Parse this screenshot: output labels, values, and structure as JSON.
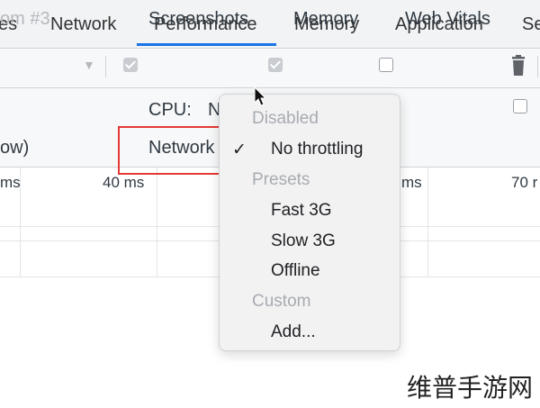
{
  "tabs": [
    {
      "label": "es",
      "active": false
    },
    {
      "label": "Network",
      "active": false
    },
    {
      "label": "Performance",
      "active": true
    },
    {
      "label": "Memory",
      "active": false
    },
    {
      "label": "Application",
      "active": false
    },
    {
      "label": "Se",
      "active": false
    }
  ],
  "toolbar": {
    "zoom_select_value": "om #3",
    "screenshots": {
      "label": "Screenshots",
      "checked": true
    },
    "memory": {
      "label": "Memory",
      "checked": true
    },
    "web_vitals": {
      "label": "Web Vitals",
      "checked": false
    },
    "trash_icon": "trash-icon"
  },
  "settings": {
    "cpu_label": "CPU:",
    "cpu_value_partial": "N",
    "row2_left": "ow)",
    "network_label": "Network",
    "right_checkbox_checked": false
  },
  "ruler": {
    "ticks": [
      "ms",
      "40 ms",
      "ms",
      "70 r"
    ]
  },
  "network_menu": {
    "sections": [
      {
        "header": "Disabled",
        "items": [
          {
            "label": "No throttling",
            "selected": true
          }
        ]
      },
      {
        "header": "Presets",
        "items": [
          {
            "label": "Fast 3G",
            "selected": false
          },
          {
            "label": "Slow 3G",
            "selected": false
          },
          {
            "label": "Offline",
            "selected": false
          }
        ]
      },
      {
        "header": "Custom",
        "items": [
          {
            "label": "Add...",
            "selected": false
          }
        ]
      }
    ],
    "checkmark": "✓"
  },
  "watermark": "维普手游网",
  "colors": {
    "accent": "#1a73e8",
    "highlight": "#e53935"
  }
}
